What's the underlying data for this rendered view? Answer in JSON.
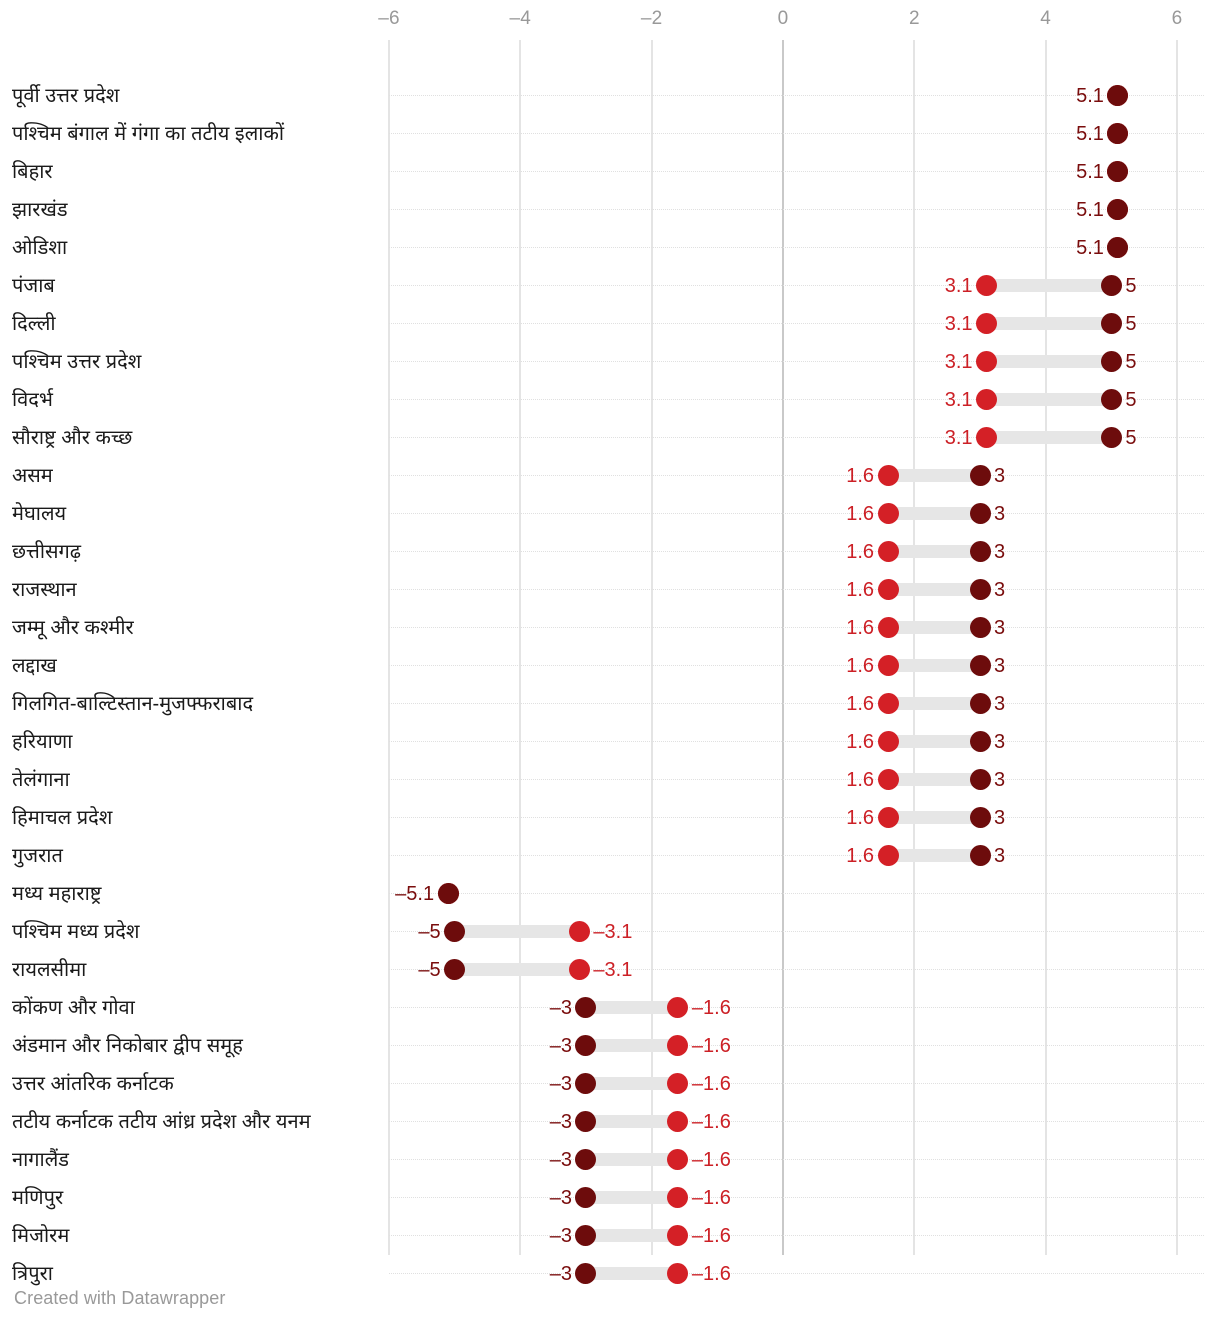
{
  "footer": {
    "credit": "Created with Datawrapper"
  },
  "axis": {
    "ticks": [
      "–6",
      "–4",
      "–2",
      "0",
      "2",
      "4",
      "6"
    ],
    "tick_values": [
      -6,
      -4,
      -2,
      0,
      2,
      4,
      6
    ],
    "min": -6.6,
    "max": 6.6,
    "zero_value": 0
  },
  "colors": {
    "low_dot": "#d42026",
    "high_dot": "#6d0c0c",
    "connector": "#e6e6e6",
    "grid": "#e4e4e4",
    "zero_grid": "#c9c9c9",
    "label_text": "#1a1a1a",
    "tick_text": "#999999",
    "footer_text": "#999999"
  },
  "chart_data": {
    "type": "dumbbell",
    "title": "",
    "subtitle": "",
    "xlabel": "",
    "ylabel": "",
    "xlim": [
      -6.6,
      6.6
    ],
    "grid": true,
    "legend": "none",
    "series": [
      {
        "name": "low",
        "color": "#d42026"
      },
      {
        "name": "high",
        "color": "#6d0c0c"
      }
    ],
    "categories": [
      "पूर्वी उत्तर प्रदेश",
      "पश्चिम बंगाल में गंगा का तटीय इलाकों",
      "बिहार",
      "झारखंड",
      "ओडिशा",
      "पंजाब",
      "दिल्ली",
      "पश्चिम उत्तर प्रदेश",
      "विदर्भ",
      "सौराष्ट्र और कच्छ",
      "असम",
      "मेघालय",
      "छत्तीसगढ़",
      "राजस्थान",
      "जम्मू और कश्मीर",
      "लद्दाख",
      "गिलगित-बाल्टिस्तान-मुजफ्फराबाद",
      "हरियाणा",
      "तेलंगाना",
      "हिमाचल प्रदेश",
      "गुजरात",
      "मध्य महाराष्ट्र",
      "पश्चिम मध्य प्रदेश",
      "रायलसीमा",
      "कोंकण और गोवा",
      "अंडमान और निकोबार द्वीप समूह",
      "उत्तर आंतरिक कर्नाटक",
      "तटीय कर्नाटक तटीय आंध्र प्रदेश और यनम",
      "नागालैंड",
      "मणिपुर",
      "मिजोरम",
      "त्रिपुरा"
    ],
    "low_values": [
      5.1,
      5.1,
      5.1,
      5.1,
      5.1,
      3.1,
      3.1,
      3.1,
      3.1,
      3.1,
      1.6,
      1.6,
      1.6,
      1.6,
      1.6,
      1.6,
      1.6,
      1.6,
      1.6,
      1.6,
      1.6,
      -5.1,
      -3.1,
      -3.1,
      -1.6,
      -1.6,
      -1.6,
      -1.6,
      -1.6,
      -1.6,
      -1.6,
      -1.6
    ],
    "high_values": [
      5.1,
      5.1,
      5.1,
      5.1,
      5.1,
      5,
      5,
      5,
      5,
      5,
      3,
      3,
      3,
      3,
      3,
      3,
      3,
      3,
      3,
      3,
      3,
      -5.1,
      -5,
      -5,
      -3,
      -3,
      -3,
      -3,
      -3,
      -3,
      -3,
      -3
    ]
  },
  "rows": [
    {
      "label": "पूर्वी उत्तर प्रदेश",
      "low": 5.1,
      "high": 5.1,
      "low_text": "5.1",
      "high_text": "5.1",
      "collapsed": true
    },
    {
      "label": "पश्चिम बंगाल में गंगा का तटीय इलाकों",
      "low": 5.1,
      "high": 5.1,
      "low_text": "5.1",
      "high_text": "5.1",
      "collapsed": true
    },
    {
      "label": "बिहार",
      "low": 5.1,
      "high": 5.1,
      "low_text": "5.1",
      "high_text": "5.1",
      "collapsed": true
    },
    {
      "label": "झारखंड",
      "low": 5.1,
      "high": 5.1,
      "low_text": "5.1",
      "high_text": "5.1",
      "collapsed": true
    },
    {
      "label": "ओडिशा",
      "low": 5.1,
      "high": 5.1,
      "low_text": "5.1",
      "high_text": "5.1",
      "collapsed": true
    },
    {
      "label": "पंजाब",
      "low": 3.1,
      "high": 5,
      "low_text": "3.1",
      "high_text": "5",
      "collapsed": false
    },
    {
      "label": "दिल्ली",
      "low": 3.1,
      "high": 5,
      "low_text": "3.1",
      "high_text": "5",
      "collapsed": false
    },
    {
      "label": "पश्चिम उत्तर प्रदेश",
      "low": 3.1,
      "high": 5,
      "low_text": "3.1",
      "high_text": "5",
      "collapsed": false
    },
    {
      "label": "विदर्भ",
      "low": 3.1,
      "high": 5,
      "low_text": "3.1",
      "high_text": "5",
      "collapsed": false
    },
    {
      "label": "सौराष्ट्र और कच्छ",
      "low": 3.1,
      "high": 5,
      "low_text": "3.1",
      "high_text": "5",
      "collapsed": false
    },
    {
      "label": "असम",
      "low": 1.6,
      "high": 3,
      "low_text": "1.6",
      "high_text": "3",
      "collapsed": false
    },
    {
      "label": "मेघालय",
      "low": 1.6,
      "high": 3,
      "low_text": "1.6",
      "high_text": "3",
      "collapsed": false
    },
    {
      "label": "छत्तीसगढ़",
      "low": 1.6,
      "high": 3,
      "low_text": "1.6",
      "high_text": "3",
      "collapsed": false
    },
    {
      "label": "राजस्थान",
      "low": 1.6,
      "high": 3,
      "low_text": "1.6",
      "high_text": "3",
      "collapsed": false
    },
    {
      "label": "जम्मू और कश्मीर",
      "low": 1.6,
      "high": 3,
      "low_text": "1.6",
      "high_text": "3",
      "collapsed": false
    },
    {
      "label": "लद्दाख",
      "low": 1.6,
      "high": 3,
      "low_text": "1.6",
      "high_text": "3",
      "collapsed": false
    },
    {
      "label": "गिलगित-बाल्टिस्तान-मुजफ्फराबाद",
      "low": 1.6,
      "high": 3,
      "low_text": "1.6",
      "high_text": "3",
      "collapsed": false
    },
    {
      "label": "हरियाणा",
      "low": 1.6,
      "high": 3,
      "low_text": "1.6",
      "high_text": "3",
      "collapsed": false
    },
    {
      "label": "तेलंगाना",
      "low": 1.6,
      "high": 3,
      "low_text": "1.6",
      "high_text": "3",
      "collapsed": false
    },
    {
      "label": "हिमाचल प्रदेश",
      "low": 1.6,
      "high": 3,
      "low_text": "1.6",
      "high_text": "3",
      "collapsed": false
    },
    {
      "label": "गुजरात",
      "low": 1.6,
      "high": 3,
      "low_text": "1.6",
      "high_text": "3",
      "collapsed": false
    },
    {
      "label": "मध्य महाराष्ट्र",
      "low": -5.1,
      "high": -5.1,
      "low_text": "–5.1",
      "high_text": "–5.1",
      "collapsed": true
    },
    {
      "label": "पश्चिम मध्य प्रदेश",
      "low": -3.1,
      "high": -5,
      "low_text": "–3.1",
      "high_text": "–5",
      "collapsed": false
    },
    {
      "label": "रायलसीमा",
      "low": -3.1,
      "high": -5,
      "low_text": "–3.1",
      "high_text": "–5",
      "collapsed": false
    },
    {
      "label": "कोंकण और गोवा",
      "low": -1.6,
      "high": -3,
      "low_text": "–1.6",
      "high_text": "–3",
      "collapsed": false
    },
    {
      "label": "अंडमान और निकोबार द्वीप समूह",
      "low": -1.6,
      "high": -3,
      "low_text": "–1.6",
      "high_text": "–3",
      "collapsed": false
    },
    {
      "label": "उत्तर आंतरिक कर्नाटक",
      "low": -1.6,
      "high": -3,
      "low_text": "–1.6",
      "high_text": "–3",
      "collapsed": false
    },
    {
      "label": "तटीय कर्नाटक तटीय आंध्र प्रदेश और यनम",
      "low": -1.6,
      "high": -3,
      "low_text": "–1.6",
      "high_text": "–3",
      "collapsed": false
    },
    {
      "label": "नागालैंड",
      "low": -1.6,
      "high": -3,
      "low_text": "–1.6",
      "high_text": "–3",
      "collapsed": false
    },
    {
      "label": "मणिपुर",
      "low": -1.6,
      "high": -3,
      "low_text": "–1.6",
      "high_text": "–3",
      "collapsed": false
    },
    {
      "label": "मिजोरम",
      "low": -1.6,
      "high": -3,
      "low_text": "–1.6",
      "high_text": "–3",
      "collapsed": false
    },
    {
      "label": "त्रिपुरा",
      "low": -1.6,
      "high": -3,
      "low_text": "–1.6",
      "high_text": "–3",
      "collapsed": false
    }
  ]
}
